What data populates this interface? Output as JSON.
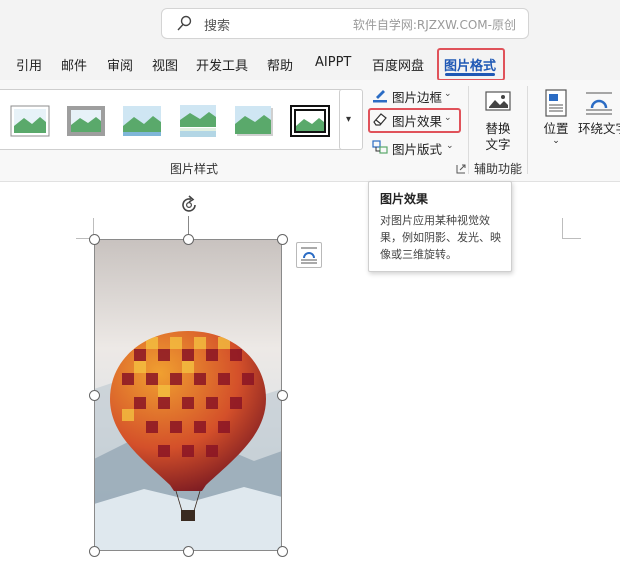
{
  "search": {
    "placeholder": "搜索",
    "watermark": "软件自学网:RJZXW.COM-原创"
  },
  "tabs": [
    {
      "label": "引用"
    },
    {
      "label": "邮件"
    },
    {
      "label": "审阅"
    },
    {
      "label": "视图"
    },
    {
      "label": "开发工具"
    },
    {
      "label": "帮助"
    },
    {
      "label": "AIPPT"
    },
    {
      "label": "百度网盘"
    },
    {
      "label": "图片格式",
      "active": true
    }
  ],
  "ribbon": {
    "styles_group_label": "图片样式",
    "border_label": "图片边框",
    "effects_label": "图片效果",
    "layout_label": "图片版式",
    "alt_text_label": "替换文字",
    "accessibility_group_label": "辅助功能",
    "position_label": "位置",
    "wrap_text_label": "环绕文字"
  },
  "tooltip": {
    "title": "图片效果",
    "body": "对图片应用某种视觉效果，例如阴影、发光、映像或三维旋转。"
  },
  "colors": {
    "accent": "#1f58b5",
    "highlight": "#e0525a"
  },
  "icons": [
    "search-icon",
    "border-pen-icon",
    "effects-eraser-icon",
    "layout-icon",
    "alt-text-icon",
    "position-icon",
    "wrap-text-icon",
    "rotate-handle-icon",
    "layout-options-icon"
  ]
}
